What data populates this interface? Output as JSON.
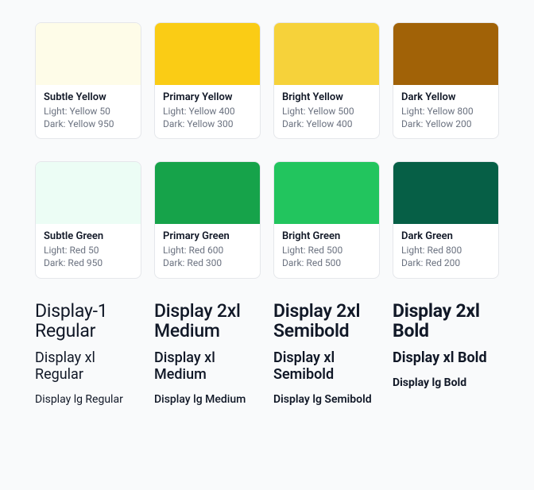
{
  "rows": [
    {
      "swatches": [
        {
          "name": "Subtle Yellow",
          "light": "Light: Yellow 50",
          "dark": "Dark: Yellow 950",
          "hex": "#fefce8"
        },
        {
          "name": "Primary Yellow",
          "light": "Light: Yellow 400",
          "dark": "Dark: Yellow 300",
          "hex": "#facc15"
        },
        {
          "name": "Bright Yellow",
          "light": "Light: Yellow 500",
          "dark": "Dark: Yellow 400",
          "hex": "#f6d23a"
        },
        {
          "name": "Dark Yellow",
          "light": "Light: Yellow 800",
          "dark": "Dark: Yellow 200",
          "hex": "#a16207"
        }
      ]
    },
    {
      "swatches": [
        {
          "name": "Subtle Green",
          "light": "Light: Red 50",
          "dark": "Dark: Red 950",
          "hex": "#ecfdf5"
        },
        {
          "name": "Primary Green",
          "light": "Light: Red 600",
          "dark": "Dark: Red 300",
          "hex": "#16a34a"
        },
        {
          "name": "Bright Green",
          "light": "Light: Red 500",
          "dark": "Dark: Red 500",
          "hex": "#22c55e"
        },
        {
          "name": "Dark Green",
          "light": "Light: Red 800",
          "dark": "Dark: Red 200",
          "hex": "#065f46"
        }
      ]
    }
  ],
  "type": {
    "cols": [
      {
        "l1": "Display-1 Regular",
        "l2": "Display xl Regular",
        "l3": "Display lg Regular",
        "weight": "reg"
      },
      {
        "l1": "Display 2xl Medium",
        "l2": "Display xl Medium",
        "l3": "Display lg Medium",
        "weight": "med"
      },
      {
        "l1": "Display 2xl Semibold",
        "l2": "Display xl Semibold",
        "l3": "Display lg Semibold",
        "weight": "semi"
      },
      {
        "l1": "Display 2xl Bold",
        "l2": "Display xl Bold",
        "l3": "Display lg Bold",
        "weight": "bold"
      }
    ]
  }
}
